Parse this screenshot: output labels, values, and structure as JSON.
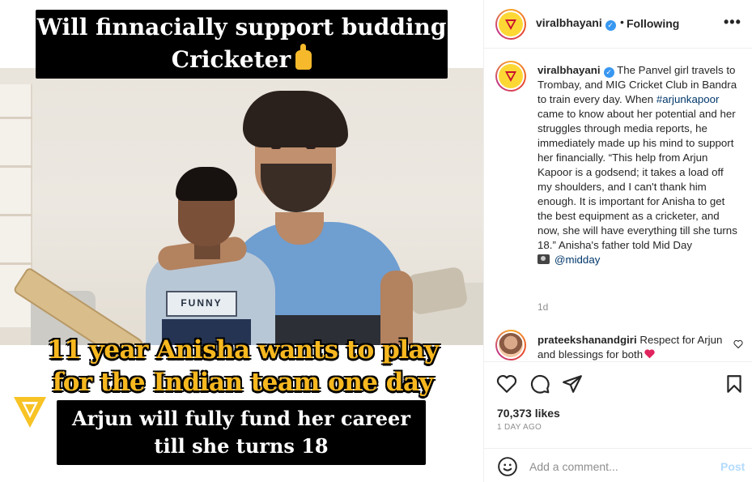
{
  "media": {
    "top_text_line1": "Will finnacially support budding",
    "top_text_line2": "Cricketer",
    "middle_text_line1": "11 year Anisha wants to play",
    "middle_text_line2": "for the Indian team one day",
    "bottom_text_line1": "Arjun will fully fund her career",
    "bottom_text_line2": "till she turns 18",
    "shirt_print": "FUNNY",
    "emoji": "thumbs-up-icon"
  },
  "header": {
    "username": "viralbhayani",
    "separator": "•",
    "follow_status": "Following",
    "more_label": "•••"
  },
  "caption": {
    "username": "viralbhayani",
    "text_before_hashtag": "The Panvel girl travels to Trombay, and MIG Cricket Club in Bandra to train every day. When ",
    "hashtag": "#arjunkapoor",
    "text_after_hashtag": " came to know about her potential and her struggles through media reports, he immediately made up his mind to support her financially. “This help from Arjun Kapoor is a godsend; it takes a load off my shoulders, and I can't thank him enough. It is important for Anisha to get the best equipment as a cricketer, and now, she will have everything till she turns 18.” Anisha's father told Mid Day",
    "mention": "@midday",
    "age": "1d"
  },
  "comment": {
    "username": "prateekshanandgiri",
    "text": "Respect for Arjun and blessings for both"
  },
  "footer": {
    "likes": "70,373 likes",
    "date": "1 DAY AGO",
    "comment_placeholder": "Add a comment...",
    "post_label": "Post"
  },
  "colors": {
    "brand_yellow": "#fdd835",
    "link_blue": "#00376b",
    "verified_blue": "#3897f0",
    "post_disabled": "#b3dbff",
    "overlay_yellow": "#f7b81f"
  }
}
